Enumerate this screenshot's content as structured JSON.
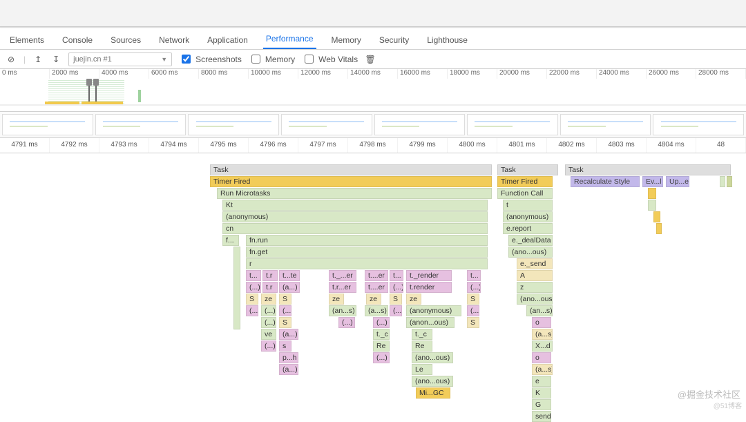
{
  "tabs": {
    "elements": "Elements",
    "console": "Console",
    "sources": "Sources",
    "network": "Network",
    "application": "Application",
    "performance": "Performance",
    "memory": "Memory",
    "security": "Security",
    "lighthouse": "Lighthouse"
  },
  "toolbar": {
    "clear_icon": "⊘",
    "upload_icon": "↥",
    "download_icon": "↧",
    "record_dropdown": "juejin.cn #1",
    "chk_screenshots": "Screenshots",
    "chk_memory": "Memory",
    "chk_webvitals": "Web Vitals",
    "trash_icon": "🗑"
  },
  "overview_ticks": [
    "0 ms",
    "2000 ms",
    "4000 ms",
    "6000 ms",
    "8000 ms",
    "10000 ms",
    "12000 ms",
    "14000 ms",
    "16000 ms",
    "18000 ms",
    "20000 ms",
    "22000 ms",
    "24000 ms",
    "26000 ms",
    "28000 ms"
  ],
  "detail_ticks": [
    "4791 ms",
    "4792 ms",
    "4793 ms",
    "4794 ms",
    "4795 ms",
    "4796 ms",
    "4797 ms",
    "4798 ms",
    "4799 ms",
    "4800 ms",
    "4801 ms",
    "4802 ms",
    "4803 ms",
    "4804 ms",
    "48"
  ],
  "flame": {
    "task1": "Task",
    "task2": "Task",
    "task3": "Task",
    "timer1": "Timer Fired",
    "timer2": "Timer Fired",
    "recalc": "Recalculate Style",
    "ev": "Ev...l",
    "up": "Up...e",
    "runmt": "Run Microtasks",
    "funcall": "Function Call",
    "kt": "Kt",
    "anon": "(anonymous)",
    "cn": "cn",
    "f": "f...",
    "fnrun": "fn.run",
    "fnget": "fn.get",
    "r": "r",
    "tdot": "t._...er",
    "trdot": "t.r...er",
    "tdoter": "t....er",
    "trender": "t._render",
    "trender2": "t.render",
    "S": "S",
    "ze": "ze",
    "anons": "(an...s)",
    "anons2": "(a...s)",
    "parenell": "(...)",
    "ve": "ve",
    "aell": "(a...)",
    "s_low": "s",
    "ph": "p...h",
    "anonous": "(anon...ous)",
    "anoous": "(ano...ous)",
    "tc": "t._c",
    "Re": "Re",
    "Le": "Le",
    "migc": "Mi...GC",
    "t": "t",
    "ereport": "e.report",
    "edeal": "e._dealData",
    "esend": "e._send",
    "A": "A",
    "z": "z",
    "o": "o",
    "xd": "X...d",
    "e": "e",
    "K": "K",
    "G": "G",
    "send": "send",
    "t2": "t...",
    "tr": "t.r",
    "tte": "t...te"
  },
  "watermark": "@掘金技术社区",
  "watermark2": "@51博客"
}
